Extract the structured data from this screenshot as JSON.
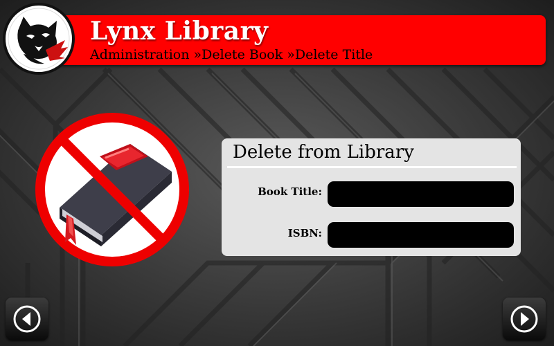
{
  "app": {
    "title": "Lynx Library",
    "accent_color": "#ff0000"
  },
  "breadcrumb": {
    "text": "Administration »Delete Book »Delete Title"
  },
  "logo": {
    "icon": "lynx-logo-icon"
  },
  "illustration": {
    "icon": "no-book-icon"
  },
  "form": {
    "title": "Delete from Library",
    "fields": [
      {
        "label": "Book Title:",
        "value": "",
        "placeholder": ""
      },
      {
        "label": "ISBN:",
        "value": "",
        "placeholder": ""
      }
    ]
  },
  "nav": {
    "back_icon": "arrow-left-icon",
    "next_icon": "arrow-right-icon"
  }
}
